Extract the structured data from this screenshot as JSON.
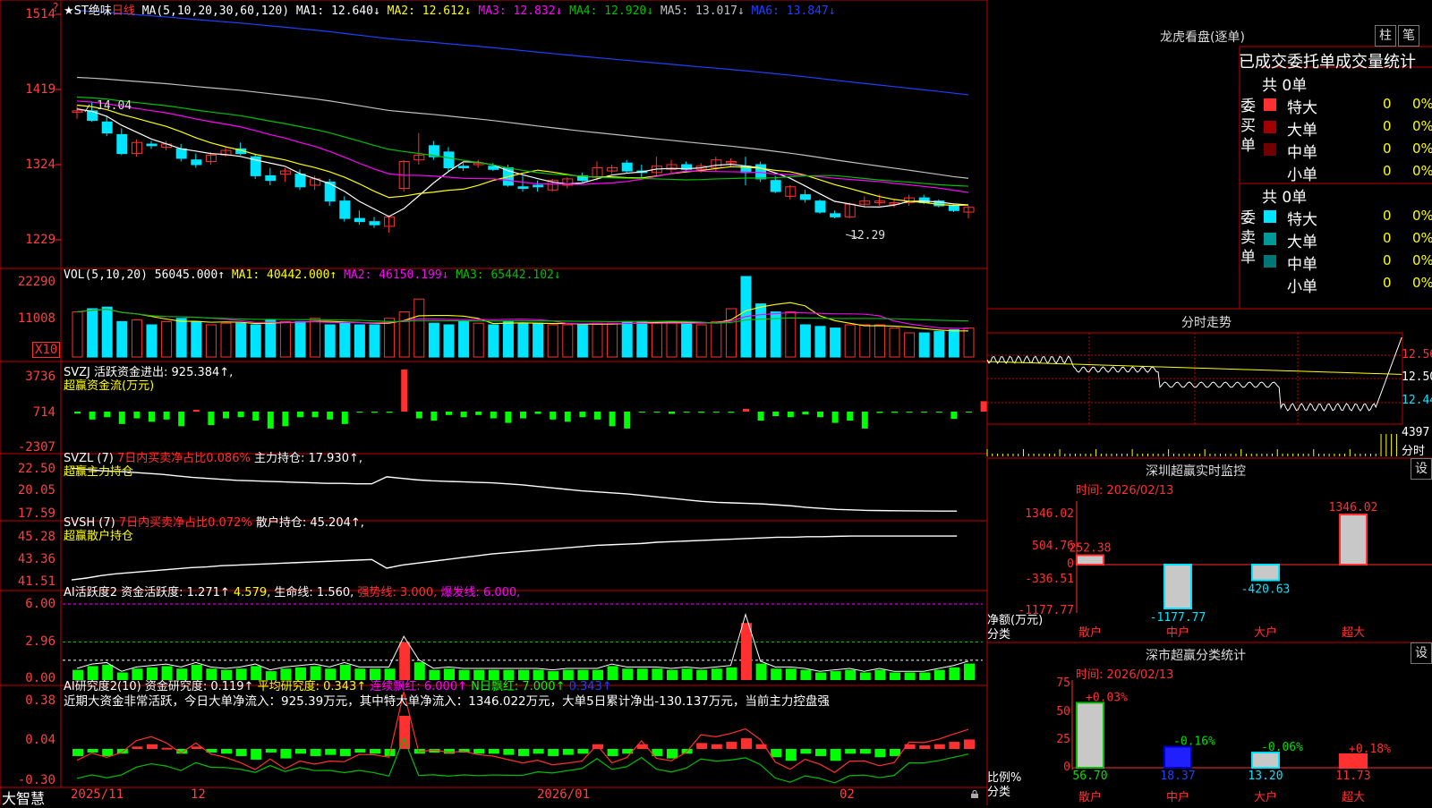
{
  "colors": {
    "up": "#ff3030",
    "down": "#00e5ff",
    "grid": "#c00000",
    "ma1": "#ffffff",
    "ma2": "#ffff00",
    "ma3": "#ff00ff",
    "ma4": "#00c000",
    "ma5": "#c0c0c0",
    "ma6": "#2040ff"
  },
  "app": {
    "brand": "大智慧",
    "scroll_icon": "lock-icon"
  },
  "main": {
    "corner_mark": "?",
    "title_prefix": "★ST绝味",
    "period": "日线",
    "ma_label": "MA(5,10,20,30,60,120)",
    "ma1": "MA1: 12.640↓",
    "ma2": "MA2: 12.612↓",
    "ma3": "MA3: 12.832↓",
    "ma4": "MA4: 12.920↓",
    "ma5": "MA5: 13.017↓",
    "ma6": "MA6: 13.847↓",
    "high_mark": "14.04",
    "low_mark": "12.29"
  },
  "vol": {
    "label": "VOL(5,10,20)",
    "value": "56045.000↑",
    "ma1": "MA1: 40442.000↑",
    "ma2": "MA2: 46150.199↓",
    "ma3": "MA3: 65442.102↓",
    "unit": "X10"
  },
  "svzj": {
    "label": "SVZJ  活跃资金进出: 925.384↑,",
    "sub": "超赢资金流(万元)"
  },
  "svzl": {
    "label": "SVZL (7)",
    "ratio": "7日内买卖净占比0.086%",
    "hold": "主力持仓: 17.930↑,",
    "sub": "超赢主力持仓"
  },
  "svsh": {
    "label": "SVSH (7)",
    "ratio": "7日内买卖净占比0.072%",
    "hold": "散户持仓: 45.204↑,",
    "sub": "超赢散户持仓"
  },
  "ai1": {
    "label": "AI活跃度2",
    "fund": "资金活跃度: 1.271↑",
    "v2": "4.579,",
    "life": "生命线: 1.560,",
    "strong": "强势线: 3.000,",
    "burst": "爆发线: 6.000,"
  },
  "ai2": {
    "label": "AI研究度2(10)",
    "fund": "资金研究度: 0.119↑",
    "avg": "平均研究度: 0.343↑",
    "cont": "连续飘红: 6.000↑",
    "nday": "N日飘红: 7.000↑",
    "v5": "0.343↑",
    "comment": "近期大资金非常活跃，今日大单净流入：925.39万元，其中特大单净流入：1346.022万元，大单5日累计净出-130.137万元，当前主力控盘强"
  },
  "x_dates": [
    "2025/11",
    "12",
    "2026/01",
    "02"
  ],
  "right": {
    "lhb_title": "龙虎看盘(逐单)",
    "btn1": "柱",
    "btn2": "笔",
    "tabs": [
      "已成交",
      "委托单",
      "成交量统计"
    ],
    "buy_side": "委买单",
    "sell_side": "委卖单",
    "buy_total": "共 0单",
    "sell_total": "共 0单",
    "order_rows": [
      {
        "name": "特大",
        "count": "0",
        "pct": "0%"
      },
      {
        "name": "大单",
        "count": "0",
        "pct": "0%"
      },
      {
        "name": "中单",
        "count": "0",
        "pct": "0%"
      },
      {
        "name": "小单",
        "count": "0",
        "pct": "0%"
      }
    ],
    "intraday_title": "分时走势",
    "intraday_ticks": [
      "12.56",
      "12.50",
      "12.44"
    ],
    "intraday_vol": "4397",
    "intraday_unit": "分时",
    "monitor_title": "深圳超赢实时监控",
    "monitor_btn": "设",
    "monitor_time": "时间: 2026/02/13",
    "monitor_ticks": [
      "1346.02",
      "504.76",
      "0",
      "-336.51",
      "-1177.77"
    ],
    "monitor_axis": "净额(万元)",
    "monitor_cat": "分类",
    "stat_title": "深市超赢分类统计",
    "stat_btn": "设",
    "stat_time": "时间: 2026/02/13",
    "stat_ticks": [
      "75",
      "50",
      "25",
      "0"
    ],
    "stat_axis": "比例%",
    "stat_cat": "分类"
  },
  "chart_data": [
    {
      "type": "candlestick",
      "title": "★ST绝味 日线",
      "y_ticks": [
        "1514",
        "1419",
        "1324",
        "1229"
      ],
      "ylim": [
        12.16,
        15.2
      ],
      "ohlc": [
        [
          13.9,
          13.98,
          13.82,
          13.92
        ],
        [
          13.92,
          14.04,
          13.78,
          13.8
        ],
        [
          13.78,
          13.86,
          13.6,
          13.64
        ],
        [
          13.62,
          13.7,
          13.36,
          13.38
        ],
        [
          13.38,
          13.56,
          13.34,
          13.52
        ],
        [
          13.5,
          13.54,
          13.44,
          13.48
        ],
        [
          13.46,
          13.54,
          13.42,
          13.5
        ],
        [
          13.44,
          13.5,
          13.28,
          13.32
        ],
        [
          13.3,
          13.38,
          13.2,
          13.24
        ],
        [
          13.28,
          13.4,
          13.24,
          13.36
        ],
        [
          13.36,
          13.46,
          13.34,
          13.42
        ],
        [
          13.44,
          13.52,
          13.36,
          13.38
        ],
        [
          13.34,
          13.38,
          13.06,
          13.1
        ],
        [
          13.1,
          13.2,
          12.98,
          13.04
        ],
        [
          13.12,
          13.2,
          13.02,
          13.16
        ],
        [
          13.12,
          13.18,
          12.92,
          12.96
        ],
        [
          12.98,
          13.1,
          12.92,
          13.06
        ],
        [
          13.02,
          13.06,
          12.72,
          12.78
        ],
        [
          12.78,
          12.84,
          12.52,
          12.56
        ],
        [
          12.56,
          12.66,
          12.48,
          12.52
        ],
        [
          12.52,
          12.58,
          12.44,
          12.48
        ],
        [
          12.46,
          12.6,
          12.38,
          12.58
        ],
        [
          12.94,
          13.3,
          12.9,
          13.28
        ],
        [
          13.3,
          13.64,
          13.24,
          13.36
        ],
        [
          13.48,
          13.54,
          13.3,
          13.34
        ],
        [
          13.4,
          13.46,
          13.16,
          13.2
        ],
        [
          13.22,
          13.26,
          13.16,
          13.2
        ],
        [
          13.24,
          13.3,
          13.2,
          13.26
        ],
        [
          13.22,
          13.26,
          13.16,
          13.18
        ],
        [
          13.2,
          13.24,
          12.96,
          12.98
        ],
        [
          12.96,
          13.1,
          12.9,
          12.94
        ],
        [
          12.98,
          13.04,
          12.9,
          12.96
        ],
        [
          12.92,
          13.06,
          12.9,
          13.04
        ],
        [
          12.98,
          13.08,
          12.94,
          13.06
        ],
        [
          13.1,
          13.14,
          13.02,
          13.04
        ],
        [
          13.08,
          13.28,
          13.04,
          13.2
        ],
        [
          13.16,
          13.24,
          13.12,
          13.2
        ],
        [
          13.26,
          13.3,
          13.14,
          13.16
        ],
        [
          13.16,
          13.24,
          13.08,
          13.14
        ],
        [
          13.14,
          13.34,
          13.1,
          13.22
        ],
        [
          13.18,
          13.3,
          13.14,
          13.24
        ],
        [
          13.24,
          13.28,
          13.16,
          13.18
        ],
        [
          13.18,
          13.26,
          13.14,
          13.22
        ],
        [
          13.2,
          13.34,
          13.16,
          13.3
        ],
        [
          13.28,
          13.32,
          13.22,
          13.28
        ],
        [
          13.22,
          13.34,
          12.98,
          13.14
        ],
        [
          13.24,
          13.28,
          13.02,
          13.06
        ],
        [
          13.04,
          13.1,
          12.88,
          12.9
        ],
        [
          12.84,
          12.98,
          12.8,
          12.96
        ],
        [
          12.86,
          12.92,
          12.76,
          12.8
        ],
        [
          12.78,
          12.8,
          12.62,
          12.64
        ],
        [
          12.62,
          12.66,
          12.56,
          12.58
        ],
        [
          12.58,
          12.76,
          12.56,
          12.74
        ],
        [
          12.74,
          12.84,
          12.7,
          12.78
        ],
        [
          12.76,
          12.86,
          12.72,
          12.78
        ],
        [
          12.74,
          12.8,
          12.7,
          12.76
        ],
        [
          12.76,
          12.86,
          12.72,
          12.82
        ],
        [
          12.82,
          12.86,
          12.74,
          12.76
        ],
        [
          12.78,
          12.8,
          12.7,
          12.72
        ],
        [
          12.72,
          12.74,
          12.64,
          12.66
        ],
        [
          12.64,
          12.72,
          12.56,
          12.7
        ]
      ]
    },
    {
      "type": "bar",
      "title": "VOL(5,10,20)",
      "y_ticks": [
        "22290",
        "11008",
        "X10"
      ],
      "values": [
        56,
        60,
        62,
        44,
        46,
        40,
        44,
        48,
        44,
        40,
        42,
        42,
        40,
        46,
        44,
        44,
        48,
        40,
        42,
        40,
        40,
        48,
        56,
        72,
        42,
        40,
        44,
        42,
        40,
        44,
        42,
        42,
        40,
        40,
        40,
        42,
        42,
        44,
        44,
        42,
        44,
        42,
        40,
        44,
        60,
        100,
        66,
        56,
        56,
        40,
        38,
        36,
        40,
        40,
        40,
        36,
        30,
        30,
        32,
        34,
        36
      ]
    },
    {
      "type": "bar",
      "title": "SVZJ 活跃资金进出",
      "y_ticks": [
        "3736",
        "714",
        "-2307"
      ],
      "values": [
        -180,
        -700,
        -500,
        -1100,
        -600,
        -900,
        -700,
        -1300,
        160,
        -1200,
        -600,
        -500,
        -800,
        -1500,
        -1300,
        -500,
        -500,
        -700,
        -1100,
        -80,
        -100,
        -100,
        3736,
        -600,
        -800,
        -300,
        -500,
        -300,
        -600,
        -1000,
        -600,
        -200,
        -700,
        -900,
        -500,
        -700,
        -1300,
        -1500,
        -60,
        -40,
        -200,
        -60,
        -100,
        -60,
        -100,
        240,
        -800,
        -400,
        -500,
        -250,
        -500,
        -1000,
        -800,
        -1500,
        -120,
        -100,
        -80,
        -60,
        -60,
        -650,
        -60,
        925
      ]
    },
    {
      "type": "line",
      "title": "SVZL 主力持仓",
      "y_ticks": [
        "22.50",
        "20.05",
        "17.59"
      ],
      "values": [
        22.2,
        22.1,
        21.95,
        21.9,
        21.8,
        21.7,
        21.6,
        21.45,
        21.3,
        21.2,
        21.1,
        21.0,
        20.95,
        20.9,
        20.85,
        20.8,
        20.75,
        20.7,
        20.7,
        20.65,
        20.65,
        21.35,
        21.2,
        21.05,
        20.95,
        20.9,
        20.85,
        20.8,
        20.75,
        20.65,
        20.55,
        20.4,
        20.25,
        20.1,
        19.95,
        19.85,
        19.75,
        19.65,
        19.5,
        19.35,
        19.2,
        19.05,
        18.9,
        18.8,
        18.75,
        18.7,
        18.65,
        18.55,
        18.45,
        18.3,
        18.2,
        18.1,
        18.05,
        18.0,
        17.98,
        17.96,
        17.95,
        17.94,
        17.93,
        17.93
      ]
    },
    {
      "type": "line",
      "title": "SVSH 散户持仓",
      "y_ticks": [
        "45.28",
        "43.36",
        "41.51"
      ],
      "values": [
        41.65,
        41.8,
        42.0,
        42.15,
        42.25,
        42.35,
        42.45,
        42.55,
        42.65,
        42.7,
        42.8,
        42.85,
        42.9,
        42.95,
        43.0,
        43.05,
        43.1,
        43.15,
        43.2,
        43.25,
        43.3,
        42.6,
        42.85,
        43.0,
        43.15,
        43.3,
        43.45,
        43.6,
        43.75,
        43.85,
        43.95,
        44.05,
        44.15,
        44.25,
        44.35,
        44.45,
        44.5,
        44.55,
        44.6,
        44.7,
        44.75,
        44.8,
        44.85,
        44.9,
        44.95,
        45.0,
        45.05,
        45.1,
        45.1,
        45.15,
        45.15,
        45.18,
        45.2,
        45.2,
        45.2,
        45.2,
        45.2,
        45.2,
        45.2,
        45.204
      ]
    },
    {
      "type": "bar",
      "title": "AI活跃度2",
      "y_ticks": [
        "6.00",
        "2.96",
        "0.00"
      ],
      "values": [
        0.8,
        1.1,
        1.2,
        0.6,
        0.9,
        1.0,
        1.1,
        0.9,
        1.2,
        0.9,
        0.8,
        0.9,
        1.1,
        0.7,
        0.9,
        1.0,
        1.1,
        0.9,
        1.2,
        0.9,
        0.9,
        0.9,
        3.0,
        1.4,
        0.8,
        0.9,
        0.8,
        0.8,
        0.8,
        0.8,
        0.8,
        0.8,
        0.7,
        0.8,
        0.8,
        0.8,
        1.1,
        0.9,
        0.9,
        0.9,
        0.8,
        0.9,
        0.8,
        0.9,
        1.0,
        4.5,
        1.3,
        0.9,
        0.9,
        0.8,
        0.6,
        0.7,
        0.8,
        0.6,
        0.8,
        0.6,
        0.6,
        0.6,
        0.8,
        1.0,
        1.3
      ]
    },
    {
      "type": "bar",
      "title": "AI研究度2(10)",
      "y_ticks": [
        "0.38",
        "0.04",
        "-0.30"
      ],
      "values": [
        -0.06,
        -0.03,
        -0.06,
        -0.04,
        0.02,
        0.04,
        0.01,
        -0.04,
        0.02,
        -0.03,
        -0.04,
        -0.06,
        -0.09,
        -0.03,
        -0.08,
        -0.04,
        -0.06,
        -0.05,
        -0.06,
        -0.03,
        -0.04,
        -0.06,
        0.28,
        -0.04,
        -0.03,
        -0.04,
        -0.03,
        -0.04,
        -0.04,
        -0.05,
        -0.06,
        -0.04,
        -0.06,
        -0.05,
        -0.04,
        0.04,
        -0.06,
        -0.04,
        0.04,
        -0.06,
        -0.08,
        -0.04,
        0.05,
        0.04,
        0.06,
        0.09,
        0.04,
        -0.07,
        -0.1,
        -0.04,
        -0.06,
        -0.1,
        -0.04,
        -0.04,
        -0.07,
        -0.06,
        0.04,
        0.03,
        0.04,
        0.06,
        0.08
      ]
    },
    {
      "type": "bar",
      "title": "深圳超赢实时监控",
      "categories": [
        "散户",
        "中户",
        "大户",
        "超大"
      ],
      "values": [
        252.38,
        -1177.77,
        -420.63,
        1346.02
      ],
      "ylim": [
        -1177.77,
        1346.02
      ]
    },
    {
      "type": "bar",
      "title": "深市超赢分类统计",
      "categories": [
        "散户",
        "中户",
        "大户",
        "超大"
      ],
      "values": [
        56.7,
        18.37,
        13.2,
        11.73
      ],
      "changes": [
        "+0.03%",
        "-0.16%",
        "-0.06%",
        "+0.18%"
      ],
      "ylim": [
        0,
        75
      ]
    }
  ]
}
